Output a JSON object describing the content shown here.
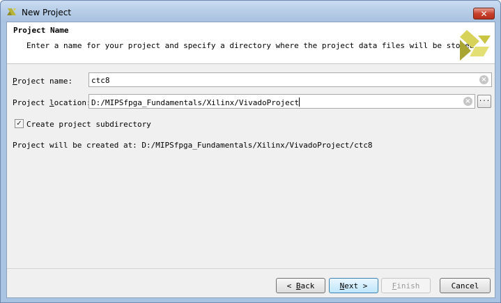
{
  "window": {
    "title": "New Project",
    "close_label": "✕"
  },
  "header": {
    "title": "Project Name",
    "description": "Enter a name for your project and specify a directory where the project data files will be stored."
  },
  "form": {
    "name_label_u": "P",
    "name_label_rest": "roject name:",
    "name_value": "ctc8",
    "location_label_pre": "Project ",
    "location_label_u": "l",
    "location_label_rest": "ocation:",
    "location_value": "D:/MIPSfpga_Fundamentals/Xilinx/VivadoProject",
    "browse_label": "...",
    "subdir_checked": true,
    "subdir_label": "Create project subdirectory",
    "created_at_text": "Project will be created at: D:/MIPSfpga_Fundamentals/Xilinx/VivadoProject/ctc8"
  },
  "buttons": {
    "back_arrow": "<",
    "back_u": "B",
    "back_rest": "ack",
    "next_u": "N",
    "next_rest": "ext",
    "next_arrow": ">",
    "finish_u": "F",
    "finish_rest": "inish",
    "cancel": "Cancel"
  },
  "icons": {
    "title_logo": "vivado-logo-icon",
    "header_logo": "vivado-logo-icon",
    "clear": "clear-icon",
    "check": "checkmark-icon"
  },
  "colors": {
    "title_bar": "#b4cbe6",
    "close_button": "#c7412c",
    "logo": "#c9c442",
    "primary_button": "#bee6fd"
  }
}
